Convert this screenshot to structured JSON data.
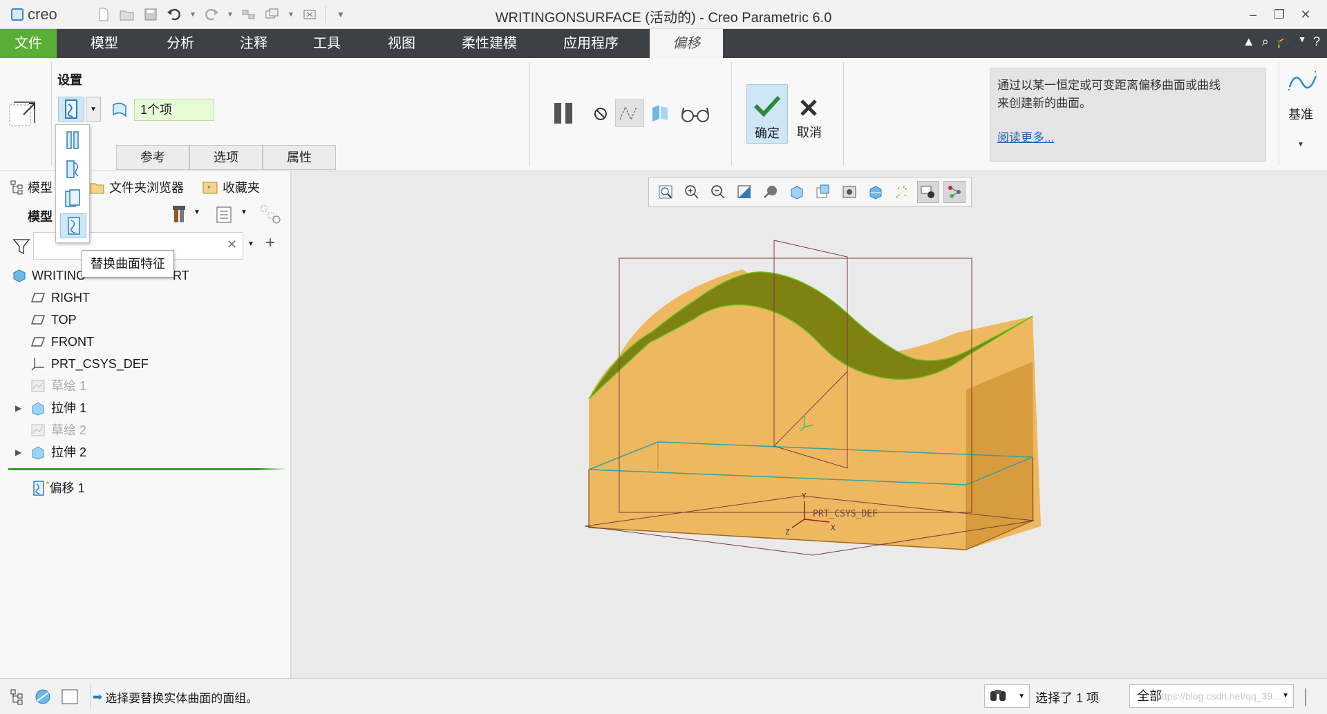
{
  "titlebar": {
    "logo_text": "creo",
    "window_title": "WRITINGONSURFACE (活动的) - Creo Parametric 6.0",
    "qat_icons": [
      "new-icon",
      "open-icon",
      "save-icon",
      "undo-icon",
      "redo-icon",
      "regenerate-icon",
      "windows-icon",
      "close-window-icon",
      "customize-icon"
    ],
    "controls": {
      "minimize": "–",
      "restore": "❐",
      "close": "✕"
    }
  },
  "tabs": {
    "file": "文件",
    "model": "模型",
    "analysis": "分析",
    "annotate": "注释",
    "tools": "工具",
    "view": "视图",
    "flexible": "柔性建模",
    "apps": "应用程序",
    "offset": "偏移"
  },
  "ribbon": {
    "settings_label": "设置",
    "ref_collector_value": "1个项",
    "subtabs": {
      "refs": "参考",
      "options": "选项",
      "properties": "属性"
    },
    "ok_label": "确定",
    "cancel_label": "取消",
    "help_text_line1": "通过以某一恒定或可变距离偏移曲面或曲线",
    "help_text_line2": "来创建新的曲面。",
    "learn_more": "阅读更多...",
    "datum_label": "基准"
  },
  "popup": {
    "tooltip": "替换曲面特征"
  },
  "left_panel": {
    "tabs": {
      "model_tree": "模型",
      "folder_browser": "文件夹浏览器",
      "favorites": "收藏夹"
    },
    "tree_header": "模型",
    "filter_placeholder": "",
    "tree": {
      "root": "WRITINGONSURFACE.PRT",
      "root_visible": "WRITING",
      "root_tail": "RT",
      "right": "RIGHT",
      "top": "TOP",
      "front": "FRONT",
      "csys": "PRT_CSYS_DEF",
      "sketch1": "草绘 1",
      "extrude1": "拉伸 1",
      "sketch2": "草绘 2",
      "extrude2": "拉伸 2",
      "offset1": "偏移 1"
    }
  },
  "graphics": {
    "csys_label": "PRT_CSYS_DEF",
    "axis_x": "X",
    "axis_y": "Y",
    "axis_z": "Z",
    "surface_color": "#e6b04c",
    "top_surface_color": "#8a8a14"
  },
  "statusbar": {
    "message": "选择要替换实体曲面的面组。",
    "selected": "选择了 1 项",
    "filter_value": "全部",
    "watermark": "https://blog.csdn.net/qq_39..."
  }
}
